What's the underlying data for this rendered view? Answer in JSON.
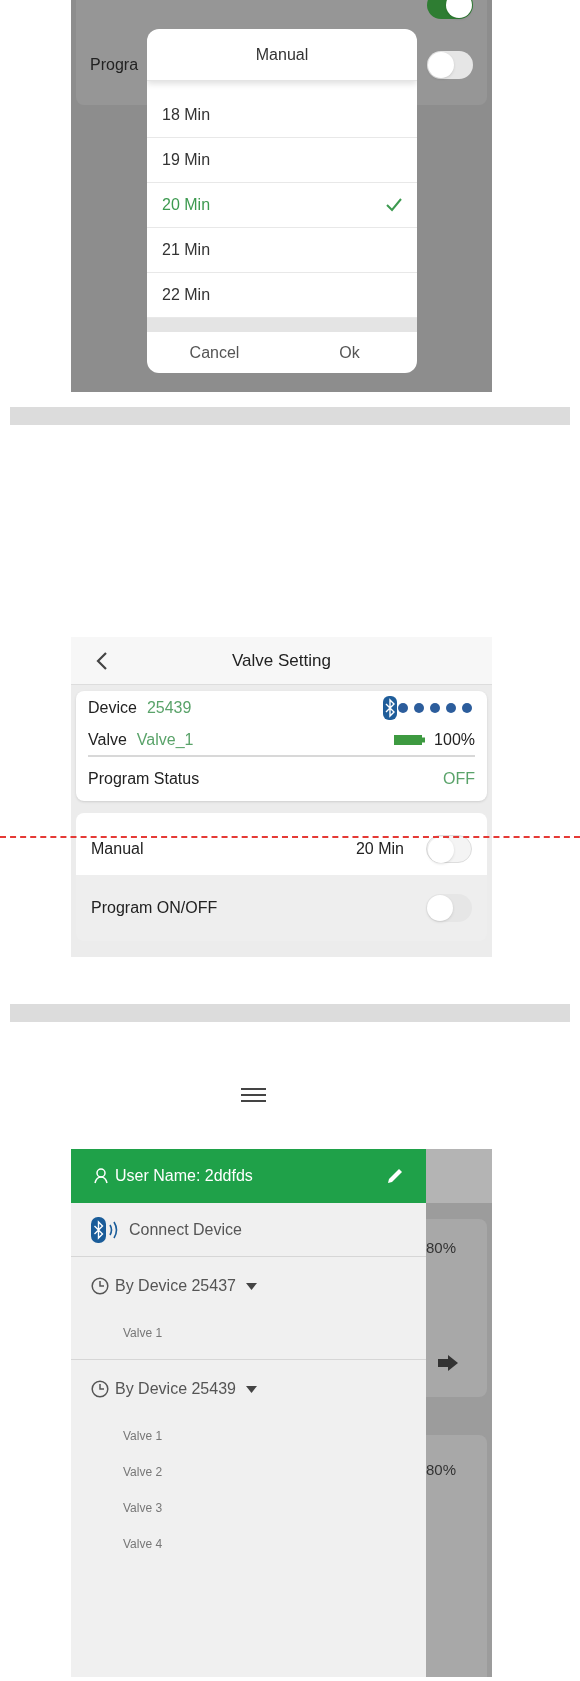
{
  "picker_screen": {
    "top_switch_on": true,
    "background_row": {
      "label": "Progra",
      "on": false
    },
    "dialog": {
      "title": "Manual",
      "options": [
        {
          "label": "18 Min",
          "selected": false
        },
        {
          "label": "19 Min",
          "selected": false
        },
        {
          "label": "20 Min",
          "selected": true
        },
        {
          "label": "21 Min",
          "selected": false
        },
        {
          "label": "22 Min",
          "selected": false
        }
      ],
      "buttons": [
        "Cancel",
        "Ok"
      ]
    }
  },
  "valve_setting": {
    "title": "Valve Setting",
    "device_label": "Device",
    "device_value": "25439",
    "valve_label": "Valve",
    "valve_value": "Valve_1",
    "battery": "100%",
    "program_status_label": "Program Status",
    "program_status_value": "OFF",
    "rows": [
      {
        "label": "Manual",
        "value": "20 Min",
        "on": false
      },
      {
        "label": "Program ON/OFF",
        "on": false
      }
    ]
  },
  "menu_screen": {
    "user_name": "User Name: 2ddfds",
    "connect": "Connect Device",
    "groups": [
      {
        "label": "By Device 25437",
        "expanded": true,
        "children": [
          {
            "label": "Valve 1"
          }
        ]
      },
      {
        "label": "By Device 25439",
        "expanded": true,
        "children": [
          {
            "label": "Valve 1"
          },
          {
            "label": "Valve 2"
          },
          {
            "label": "Valve 3"
          },
          {
            "label": "Valve 4"
          }
        ]
      }
    ],
    "background_values": [
      "80%",
      "80%"
    ]
  }
}
